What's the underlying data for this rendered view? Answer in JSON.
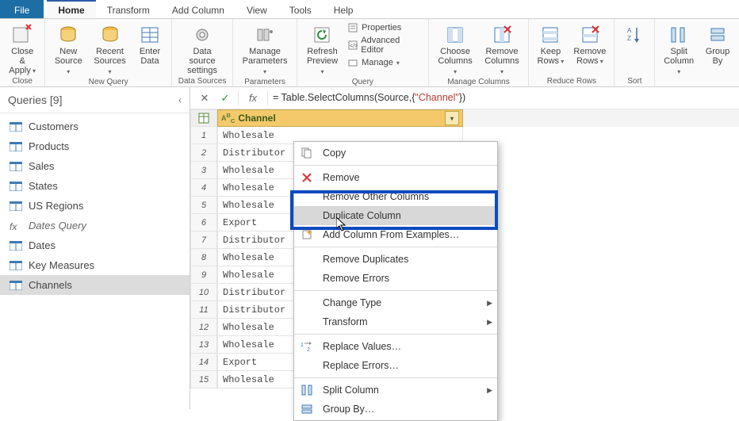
{
  "menu": {
    "file": "File",
    "tabs": [
      "Home",
      "Transform",
      "Add Column",
      "View",
      "Tools",
      "Help"
    ],
    "active": "Home"
  },
  "ribbon": {
    "close": {
      "label": "Close &\nApply",
      "group": "Close"
    },
    "new_query": {
      "group": "New Query",
      "buttons": [
        {
          "id": "new-source",
          "label": "New\nSource"
        },
        {
          "id": "recent-sources",
          "label": "Recent\nSources"
        },
        {
          "id": "enter-data",
          "label": "Enter\nData"
        }
      ]
    },
    "data_sources": {
      "group": "Data Sources",
      "buttons": [
        {
          "id": "data-source-settings",
          "label": "Data source\nsettings"
        }
      ]
    },
    "parameters": {
      "group": "Parameters",
      "buttons": [
        {
          "id": "manage-parameters",
          "label": "Manage\nParameters"
        }
      ]
    },
    "query": {
      "group": "Query",
      "refresh": {
        "label": "Refresh\nPreview"
      },
      "items": [
        {
          "id": "properties",
          "label": "Properties"
        },
        {
          "id": "advanced-editor",
          "label": "Advanced Editor"
        },
        {
          "id": "manage",
          "label": "Manage"
        }
      ]
    },
    "manage_columns": {
      "group": "Manage Columns",
      "buttons": [
        {
          "id": "choose-columns",
          "label": "Choose\nColumns"
        },
        {
          "id": "remove-columns",
          "label": "Remove\nColumns"
        }
      ]
    },
    "reduce_rows": {
      "group": "Reduce Rows",
      "buttons": [
        {
          "id": "keep-rows",
          "label": "Keep\nRows"
        },
        {
          "id": "remove-rows",
          "label": "Remove\nRows"
        }
      ]
    },
    "sort": {
      "group": "Sort",
      "buttons": [
        {
          "id": "sort-az",
          "label": ""
        }
      ]
    },
    "transform_extra": {
      "buttons": [
        {
          "id": "split-column",
          "label": "Split\nColumn"
        },
        {
          "id": "group-by",
          "label": "Group\nBy"
        }
      ]
    }
  },
  "sidebar": {
    "title": "Queries [9]",
    "items": [
      {
        "id": "customers",
        "label": "Customers",
        "icon": "table"
      },
      {
        "id": "products",
        "label": "Products",
        "icon": "table"
      },
      {
        "id": "sales",
        "label": "Sales",
        "icon": "table"
      },
      {
        "id": "states",
        "label": "States",
        "icon": "table"
      },
      {
        "id": "us-regions",
        "label": "US Regions",
        "icon": "table"
      },
      {
        "id": "dates-query",
        "label": "Dates Query",
        "icon": "fx",
        "italic": true
      },
      {
        "id": "dates",
        "label": "Dates",
        "icon": "table"
      },
      {
        "id": "key-measures",
        "label": "Key Measures",
        "icon": "table"
      },
      {
        "id": "channels",
        "label": "Channels",
        "icon": "table",
        "selected": true
      }
    ]
  },
  "formula": {
    "prefix": "= Table.SelectColumns(Source,{",
    "string": "\"Channel\"",
    "suffix": "})"
  },
  "grid": {
    "column": {
      "name": "Channel",
      "type": "ABC"
    },
    "rows": [
      {
        "n": 1,
        "v": "Wholesale"
      },
      {
        "n": 2,
        "v": "Distributor"
      },
      {
        "n": 3,
        "v": "Wholesale"
      },
      {
        "n": 4,
        "v": "Wholesale"
      },
      {
        "n": 5,
        "v": "Wholesale"
      },
      {
        "n": 6,
        "v": "Export"
      },
      {
        "n": 7,
        "v": "Distributor"
      },
      {
        "n": 8,
        "v": "Wholesale"
      },
      {
        "n": 9,
        "v": "Wholesale"
      },
      {
        "n": 10,
        "v": "Distributor"
      },
      {
        "n": 11,
        "v": "Distributor"
      },
      {
        "n": 12,
        "v": "Wholesale"
      },
      {
        "n": 13,
        "v": "Wholesale"
      },
      {
        "n": 14,
        "v": "Export"
      },
      {
        "n": 15,
        "v": "Wholesale"
      }
    ]
  },
  "context": {
    "items": [
      {
        "id": "copy",
        "label": "Copy",
        "icon": "copy"
      },
      {
        "sep": true
      },
      {
        "id": "remove",
        "label": "Remove",
        "icon": "remove"
      },
      {
        "id": "remove-other",
        "label": "Remove Other Columns"
      },
      {
        "id": "duplicate",
        "label": "Duplicate Column",
        "hover": true
      },
      {
        "id": "add-from-examples",
        "label": "Add Column From Examples…",
        "icon": "sparkle"
      },
      {
        "sep": true
      },
      {
        "id": "remove-dups",
        "label": "Remove Duplicates"
      },
      {
        "id": "remove-errors",
        "label": "Remove Errors"
      },
      {
        "sep": true
      },
      {
        "id": "change-type",
        "label": "Change Type",
        "sub": true
      },
      {
        "id": "transform",
        "label": "Transform",
        "sub": true
      },
      {
        "sep": true
      },
      {
        "id": "replace-values",
        "label": "Replace Values…",
        "icon": "replace"
      },
      {
        "id": "replace-errors",
        "label": "Replace Errors…"
      },
      {
        "sep": true
      },
      {
        "id": "split-column",
        "label": "Split Column",
        "icon": "split",
        "sub": true
      },
      {
        "id": "group-by",
        "label": "Group By…",
        "icon": "group"
      }
    ]
  }
}
